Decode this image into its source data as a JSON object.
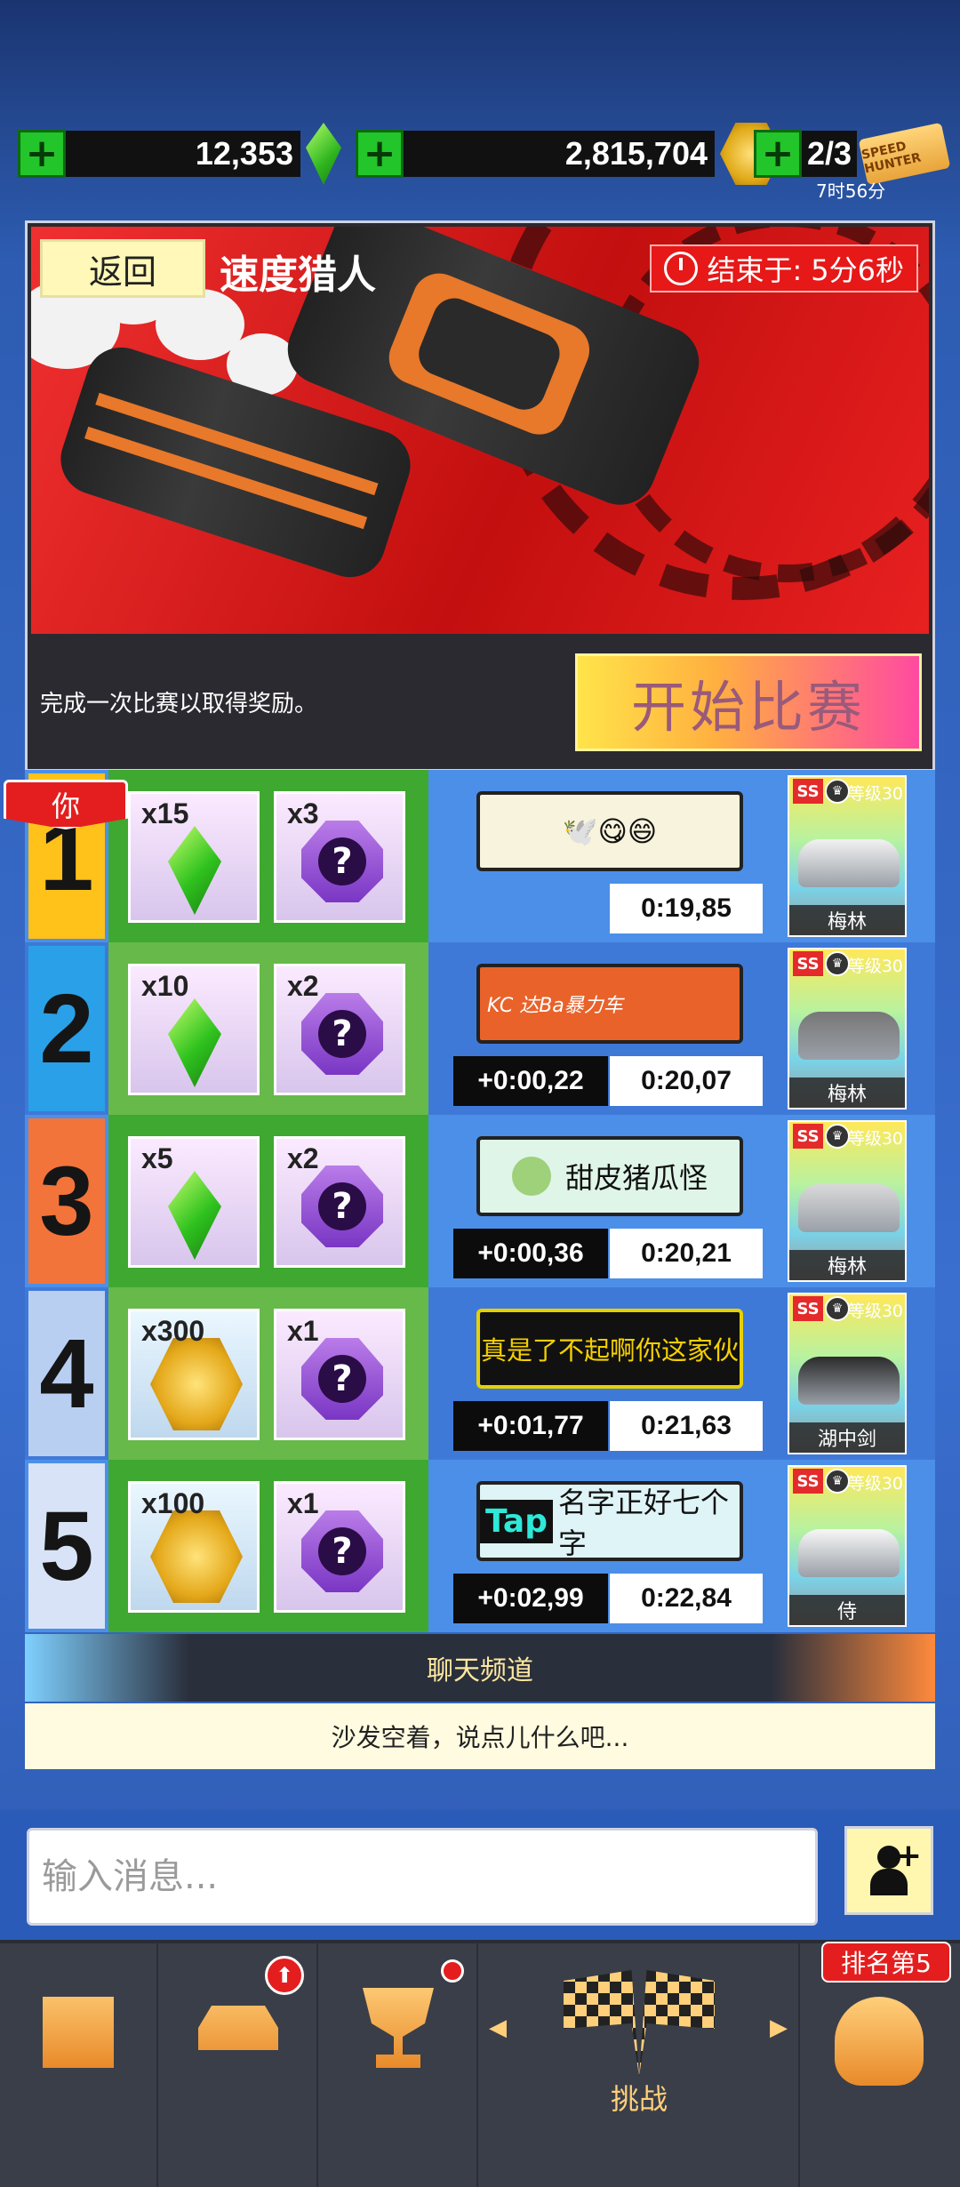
{
  "resources": {
    "gems": "12,353",
    "coins": "2,815,704",
    "tickets": "2/3",
    "ticket_timer": "7时56分",
    "ticket_icon_text": "SPEED HUNTER"
  },
  "event": {
    "back_label": "返回",
    "title": "速度猎人",
    "ends_label": "结束于:",
    "ends_value": "5分6秒",
    "description": "完成一次比赛以取得奖励。",
    "start_label": "开始比赛"
  },
  "you_tag": "你",
  "leaderboard": [
    {
      "rank": "1",
      "reward1_type": "gem",
      "reward1_count": "x15",
      "reward2_count": "x3",
      "plate": "🕊️😋😄",
      "gap": "",
      "time": "0:19,85",
      "level": "等级30",
      "car": "梅林"
    },
    {
      "rank": "2",
      "reward1_type": "gem",
      "reward1_count": "x10",
      "reward2_count": "x2",
      "plate": "KC 达Ba暴力车",
      "gap": "+0:00,22",
      "time": "0:20,07",
      "level": "等级30",
      "car": "梅林"
    },
    {
      "rank": "3",
      "reward1_type": "gem",
      "reward1_count": "x5",
      "reward2_count": "x2",
      "plate": "甜皮猪瓜怪",
      "gap": "+0:00,36",
      "time": "0:20,21",
      "level": "等级30",
      "car": "梅林"
    },
    {
      "rank": "4",
      "reward1_type": "coin",
      "reward1_count": "x300",
      "reward2_count": "x1",
      "plate": "真是了不起啊你这家伙",
      "gap": "+0:01,77",
      "time": "0:21,63",
      "level": "等级30",
      "car": "湖中剑"
    },
    {
      "rank": "5",
      "reward1_type": "coin",
      "reward1_count": "x100",
      "reward2_count": "x1",
      "plate": "名字正好七个字",
      "plate_prefix": "Tap",
      "gap": "+0:02,99",
      "time": "0:22,84",
      "level": "等级30",
      "car": "侍"
    }
  ],
  "chat": {
    "title": "聊天频道",
    "message": "沙发空着，说点儿什么吧...",
    "input_placeholder": "输入消息..."
  },
  "nav": {
    "challenge_label": "挑战",
    "rank_badge": "排名第5"
  },
  "colors": {
    "rank_colors": [
      "#ffc21a",
      "#2aa0e8",
      "#f2743a",
      "#b9cff2",
      "#d9e3f7"
    ],
    "row_bg": [
      "#4c8fe8",
      "#3f79d8",
      "#4c8fe8",
      "#3f79d8",
      "#4c8fe8"
    ],
    "reward_area": [
      "#3fa830",
      "#67b94a",
      "#3fa830",
      "#67b94a",
      "#3fa830"
    ],
    "plates": [
      "#f7f3dc",
      "#e8622a",
      "#dff5e8",
      "#111111",
      "#dff4f6"
    ],
    "plate_text": [
      "#111111",
      "#ffffff",
      "#111111",
      "#f5d000",
      "#111111"
    ],
    "plate_border": [
      "#222222",
      "#222222",
      "#222222",
      "#e8d000",
      "#222222"
    ],
    "car_colors": [
      "#f2f2f2",
      "#777777",
      "#d9d9d9",
      "#2b2b2b",
      "#f7f7f7"
    ]
  }
}
